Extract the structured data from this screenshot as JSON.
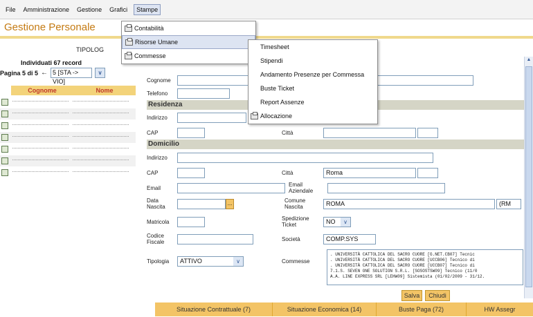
{
  "menubar": {
    "items": [
      "File",
      "Amministrazione",
      "Gestione",
      "Grafici",
      "Stampe"
    ]
  },
  "page": {
    "title": "Gestione Personale",
    "tipolo": "TIPOLOG"
  },
  "list": {
    "found": "Individuati 67 record",
    "pager_label": "Pagina 5 di 5",
    "pager_value": "5 [STA -> VIO]",
    "col_cognome": "Cognome",
    "col_nome": "Nome"
  },
  "stampe_menu": {
    "items": [
      "Contabilità",
      "Risorse Umane",
      "Commesse"
    ]
  },
  "risorse_menu": {
    "items": [
      "Timesheet",
      "Stipendi",
      "Andamento Presenze per Commessa",
      "Buste Ticket",
      "Report Assenze",
      "Allocazione"
    ]
  },
  "form": {
    "cognome": "Cognome",
    "telefono": "Telefono",
    "residenza": "Residenza",
    "indirizzo": "Indirizzo",
    "cap": "CAP",
    "citta": "Città",
    "domicilio": "Domicilio",
    "citta_value": "Roma",
    "email": "Email",
    "email_aziendale": "Email Aziendale",
    "data_nascita": "Data Nascita",
    "comune_nascita": "Comune Nascita",
    "comune_value": "ROMA",
    "prov_value": "(RM",
    "matricola": "Matricola",
    "spedizione_ticket": "Spedizione Ticket",
    "spedizione_value": "NO",
    "codice_fiscale": "Codice Fiscale",
    "societa": "Società",
    "societa_value": "COMP.SYS",
    "tipologia": "Tipologia",
    "tipologia_value": "ATTIVO",
    "commesse": "Commesse",
    "commesse_lines": [
      ". UNIVERSITÀ CATTOLICA DEL SACRO CUORE [G.NET.CB07] Tecnic",
      ". UNIVERSITÀ CATTOLICA DEL SACRO CUORE [UCCB06] Tecnico di",
      ". UNIVERSITÀ CATTOLICA DEL SACRO CUORE [UCCB07] Tecnico di",
      "7.1.S. SEVEN ONE SOLUTION S.R.L. [SOSOSTSW09] Tecnico (11/0",
      "A.A. LINE EXPRESS SRL [LEHW09] Sistemista (01/02/2009 - 31/12."
    ]
  },
  "buttons": {
    "salva": "Salva",
    "chiudi": "Chiudi"
  },
  "tabs": [
    "Situazione Contrattuale (7)",
    "Situazione Economica (14)",
    "Buste Paga (72)",
    "HW Assegr"
  ]
}
